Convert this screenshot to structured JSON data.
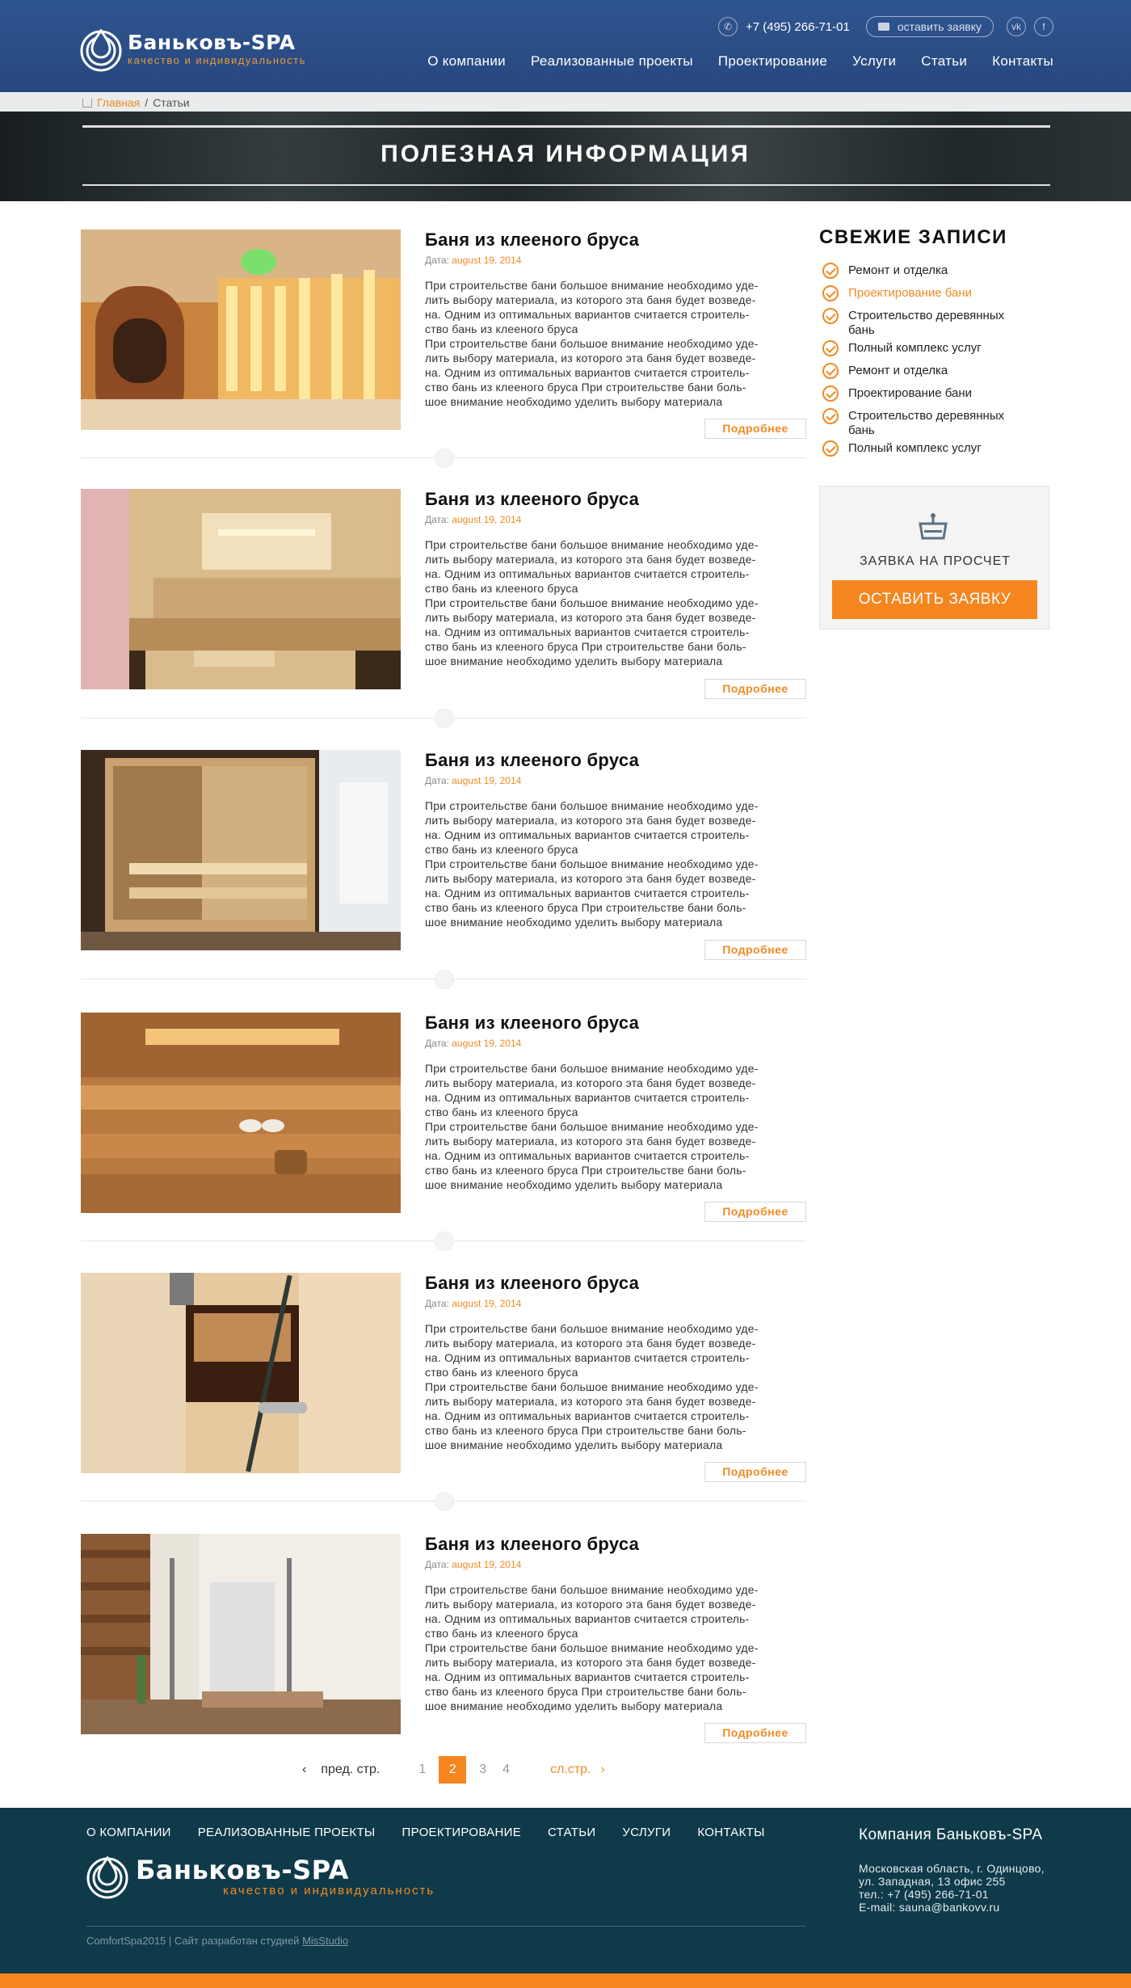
{
  "header": {
    "logo": {
      "name": "Баньковъ-SPA",
      "tagline": "качество и индивидуальность"
    },
    "phone": "+7 (495) 266-71-01",
    "request_label": "оставить заявку",
    "social": {
      "vk": "vk",
      "fb": "f"
    },
    "nav": [
      "О компании",
      "Реализованные проекты",
      "Проектирование",
      "Услуги",
      "Статьи",
      "Контакты"
    ]
  },
  "breadcrumb": {
    "home": "Главная",
    "separator": "/",
    "current": "Статьи"
  },
  "banner": {
    "title": "ПОЛЕЗНАЯ  ИНФОРМАЦИЯ"
  },
  "posts": [
    {
      "title": "Баня из клееного бруса",
      "date_label": "Дата:",
      "date": "august 19, 2014",
      "lines": [
        "При строительстве бани большое внимание необходимо уде-",
        "лить выбору материала, из которого эта баня будет возведе-",
        "на. Одним из оптимальных вариантов считается строитель-",
        "ство бань из клееного бруса",
        "При строительстве бани большое внимание необходимо уде-",
        "лить выбору материала, из которого эта баня будет возведе-",
        "на. Одним из оптимальных вариантов считается строитель-",
        "ство бань из клееного бруса При строительстве бани боль-",
        "шое внимание необходимо уделить выбору материала"
      ],
      "more": "Подробнее"
    },
    {
      "title": "Баня из клееного бруса",
      "date_label": "Дата:",
      "date": "august 19, 2014",
      "lines": [
        "При строительстве бани большое внимание необходимо уде-",
        "лить выбору материала, из которого эта баня будет возведе-",
        "на. Одним из оптимальных вариантов считается строитель-",
        "ство бань из клееного бруса",
        "При строительстве бани большое внимание необходимо уде-",
        "лить выбору материала, из которого эта баня будет возведе-",
        "на. Одним из оптимальных вариантов считается строитель-",
        "ство бань из клееного бруса При строительстве бани боль-",
        "шое внимание необходимо уделить выбору материала"
      ],
      "more": "Подробнее"
    },
    {
      "title": "Баня из клееного бруса",
      "date_label": "Дата:",
      "date": "august 19, 2014",
      "lines": [
        "При строительстве бани большое внимание необходимо уде-",
        "лить выбору материала, из которого эта баня будет возведе-",
        "на. Одним из оптимальных вариантов считается строитель-",
        "ство бань из клееного бруса",
        "При строительстве бани большое внимание необходимо уде-",
        "лить выбору материала, из которого эта баня будет возведе-",
        "на. Одним из оптимальных вариантов считается строитель-",
        "ство бань из клееного бруса При строительстве бани боль-",
        "шое внимание необходимо уделить выбору материала"
      ],
      "more": "Подробнее"
    },
    {
      "title": "Баня из клееного бруса",
      "date_label": "Дата:",
      "date": "august 19, 2014",
      "lines": [
        "При строительстве бани большое внимание необходимо уде-",
        "лить выбору материала, из которого эта баня будет возведе-",
        "на. Одним из оптимальных вариантов считается строитель-",
        "ство бань из клееного бруса",
        "При строительстве бани большое внимание необходимо уде-",
        "лить выбору материала, из которого эта баня будет возведе-",
        "на. Одним из оптимальных вариантов считается строитель-",
        "ство бань из клееного бруса При строительстве бани боль-",
        "шое внимание необходимо уделить выбору материала"
      ],
      "more": "Подробнее"
    },
    {
      "title": "Баня из клееного бруса",
      "date_label": "Дата:",
      "date": "august 19, 2014",
      "lines": [
        "При строительстве бани большое внимание необходимо уде-",
        "лить выбору материала, из которого эта баня будет возведе-",
        "на. Одним из оптимальных вариантов считается строитель-",
        "ство бань из клееного бруса",
        "При строительстве бани большое внимание необходимо уде-",
        "лить выбору материала, из которого эта баня будет возведе-",
        "на. Одним из оптимальных вариантов считается строитель-",
        "ство бань из клееного бруса При строительстве бани боль-",
        "шое внимание необходимо уделить выбору материала"
      ],
      "more": "Подробнее"
    },
    {
      "title": "Баня из клееного бруса",
      "date_label": "Дата:",
      "date": "august 19, 2014",
      "lines": [
        "При строительстве бани большое внимание необходимо уде-",
        "лить выбору материала, из которого эта баня будет возведе-",
        "на. Одним из оптимальных вариантов считается строитель-",
        "ство бань из клееного бруса",
        "При строительстве бани большое внимание необходимо уде-",
        "лить выбору материала, из которого эта баня будет возведе-",
        "на. Одним из оптимальных вариантов считается строитель-",
        "ство бань из клееного бруса При строительстве бани боль-",
        "шое внимание необходимо уделить выбору материала"
      ],
      "more": "Подробнее"
    }
  ],
  "sidebar": {
    "title": "СВЕЖИЕ ЗАПИСИ",
    "items": [
      {
        "label": "Ремонт и отделка",
        "active": false
      },
      {
        "label": "Проектирование бани",
        "active": true
      },
      {
        "label": "Строительство деревянных бань",
        "active": false
      },
      {
        "label": "Полный комплекс услуг",
        "active": false
      },
      {
        "label": "Ремонт и отделка",
        "active": false
      },
      {
        "label": "Проектирование бани",
        "active": false
      },
      {
        "label": "Строительство деревянных бань",
        "active": false
      },
      {
        "label": "Полный комплекс услуг",
        "active": false
      }
    ],
    "calc": {
      "label": "ЗАЯВКА НА ПРОСЧЕТ",
      "button": "ОСТАВИТЬ ЗАЯВКУ"
    }
  },
  "pagination": {
    "prev": "пред. стр.",
    "pages": [
      "1",
      "2",
      "3",
      "4"
    ],
    "current": "2",
    "next": "сл.стр."
  },
  "footer": {
    "nav": [
      "О КОМПАНИИ",
      "РЕАЛИЗОВАННЫЕ ПРОЕКТЫ",
      "ПРОЕКТИРОВАНИЕ",
      "СТАТЬИ",
      "УСЛУГИ",
      "КОНТАКТЫ"
    ],
    "logo": {
      "name": "Баньковъ-SPA",
      "tagline": "качество и индивидуальность"
    },
    "copyright": "ComfortSpa2015 | Сайт разработан студией",
    "studio": "MisStudio",
    "company": {
      "title": "Компания Баньковъ-SPA",
      "address1": "Московская область, г. Одинцово,",
      "address2": "ул. Западная, 13 офис 255",
      "phone": "тел.: +7 (495) 266-71-01",
      "email": "E-mail: sauna@bankovv.ru"
    }
  },
  "colors": {
    "header": "#2c4f86",
    "accent": "#f5861f",
    "footer": "#0f3a4a"
  }
}
